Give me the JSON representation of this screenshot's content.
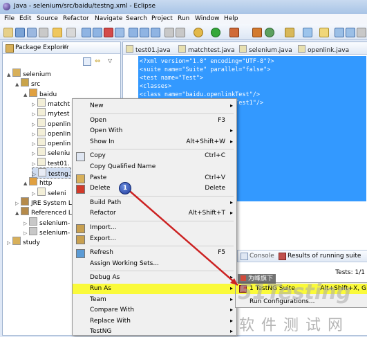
{
  "window": {
    "title": "Java - selenium/src/baidu/testng.xml - Eclipse"
  },
  "menubar": [
    "File",
    "Edit",
    "Source",
    "Refactor",
    "Navigate",
    "Search",
    "Project",
    "Run",
    "Window",
    "Help"
  ],
  "package_explorer": {
    "title": "Package Explorer",
    "tree": [
      {
        "label": "selenium",
        "indent": 1,
        "expanded": true,
        "icon": "project-icon"
      },
      {
        "label": "src",
        "indent": 2,
        "expanded": true,
        "icon": "src-folder-icon"
      },
      {
        "label": "baidu",
        "indent": 3,
        "expanded": true,
        "icon": "package-icon"
      },
      {
        "label": "matcht",
        "indent": 4,
        "icon": "java-file-icon"
      },
      {
        "label": "mytest",
        "indent": 4,
        "icon": "java-file-icon"
      },
      {
        "label": "openlin",
        "indent": 4,
        "icon": "java-file-icon"
      },
      {
        "label": "openlin",
        "indent": 4,
        "icon": "java-file-icon"
      },
      {
        "label": "openlin",
        "indent": 4,
        "icon": "java-file-icon"
      },
      {
        "label": "seleniu",
        "indent": 4,
        "icon": "java-file-icon"
      },
      {
        "label": "test01.",
        "indent": 4,
        "icon": "java-file-icon"
      },
      {
        "label": "testng.",
        "indent": 4,
        "icon": "xml-file-icon",
        "selected": true
      },
      {
        "label": "http",
        "indent": 3,
        "expanded": true,
        "icon": "package-icon"
      },
      {
        "label": "seleni",
        "indent": 4,
        "icon": "java-file-icon"
      },
      {
        "label": "JRE System L",
        "indent": 2,
        "icon": "library-icon"
      },
      {
        "label": "Referenced L",
        "indent": 2,
        "expanded": true,
        "icon": "library-icon"
      },
      {
        "label": "selenium-",
        "indent": 3,
        "icon": "jar-icon"
      },
      {
        "label": "selenium-",
        "indent": 3,
        "icon": "jar-icon"
      },
      {
        "label": "study",
        "indent": 1,
        "icon": "project-icon"
      }
    ]
  },
  "editor": {
    "tabs": [
      "test01.java",
      "matchtest.java",
      "selenium.java",
      "openlink.java"
    ],
    "code_lines": [
      "<?xml version=\"1.0\" encoding=\"UTF-8\"?>",
      "<suite name=\"Suite\" parallel=\"false\">",
      "  <test name=\"Test\">",
      "    <classes>",
      "      <class name=\"baidu.openlinkTest\"/>",
      "      <class name=\"baidu.openlinkTest1\"/>"
    ],
    "bottom_tabs": {
      "console": "Console",
      "results": "Results of running suite"
    },
    "tests_label": "Tests: 1/1"
  },
  "context_menu": {
    "items": [
      {
        "label": "New",
        "shortcut": "",
        "submenu": true
      },
      {
        "sep": true
      },
      {
        "label": "Open",
        "shortcut": "F3"
      },
      {
        "label": "Open With",
        "shortcut": "",
        "submenu": true
      },
      {
        "label": "Show In",
        "shortcut": "Alt+Shift+W",
        "submenu": true
      },
      {
        "sep": true
      },
      {
        "label": "Copy",
        "shortcut": "Ctrl+C",
        "icon": "copy-icon"
      },
      {
        "label": "Copy Qualified Name",
        "shortcut": ""
      },
      {
        "label": "Paste",
        "shortcut": "Ctrl+V",
        "icon": "paste-icon"
      },
      {
        "label": "Delete",
        "shortcut": "Delete",
        "icon": "delete-icon"
      },
      {
        "sep": true
      },
      {
        "label": "Build Path",
        "shortcut": "",
        "submenu": true
      },
      {
        "label": "Refactor",
        "shortcut": "Alt+Shift+T",
        "submenu": true
      },
      {
        "sep": true
      },
      {
        "label": "Import...",
        "shortcut": "",
        "icon": "import-icon"
      },
      {
        "label": "Export...",
        "shortcut": "",
        "icon": "export-icon"
      },
      {
        "sep": true
      },
      {
        "label": "Refresh",
        "shortcut": "F5",
        "icon": "refresh-icon"
      },
      {
        "label": "Assign Working Sets...",
        "shortcut": ""
      },
      {
        "sep": true
      },
      {
        "label": "Debug As",
        "shortcut": "",
        "submenu": true
      },
      {
        "label": "Run As",
        "shortcut": "",
        "submenu": true,
        "highlight": true
      },
      {
        "label": "Team",
        "shortcut": "",
        "submenu": true
      },
      {
        "label": "Compare With",
        "shortcut": "",
        "submenu": true
      },
      {
        "label": "Replace With",
        "shortcut": "",
        "submenu": true
      },
      {
        "label": "TestNG",
        "shortcut": "",
        "submenu": true
      }
    ]
  },
  "run_as_submenu": {
    "items": [
      {
        "label": "1 TestNG Suite",
        "shortcut": "Alt+Shift+X, G",
        "highlight": true
      },
      {
        "label": "Run Configurations...",
        "shortcut": ""
      }
    ]
  },
  "annotation": {
    "badge": "1",
    "tooltip": "为峰旗下"
  },
  "watermark": {
    "latin": "51Testing",
    "chinese": "软件测试网"
  }
}
